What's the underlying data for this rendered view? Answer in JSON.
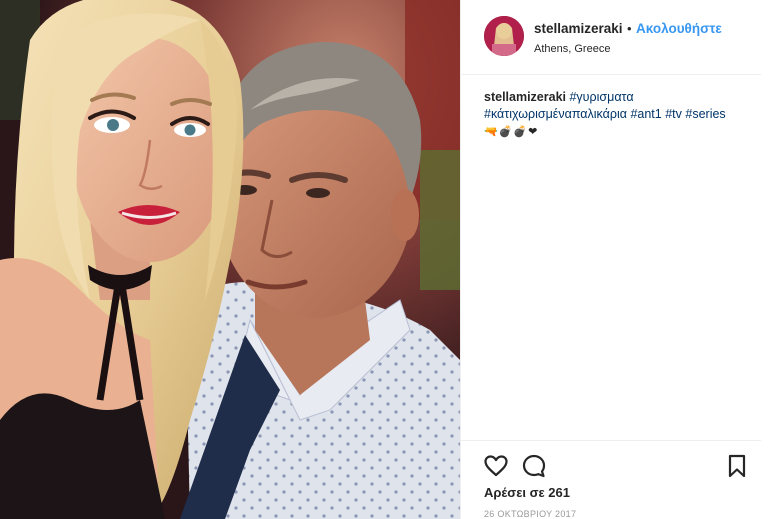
{
  "header": {
    "username": "stellamizeraki",
    "separator": "•",
    "follow_label": "Ακολουθήστε",
    "location": "Athens, Greece"
  },
  "caption": {
    "username": "stellamizeraki",
    "hashtags": [
      "#γυρισματα",
      "#κάτιχωρισμέναπαλικάρια",
      "#ant1",
      "#tv",
      "#series"
    ],
    "emoji_line": "🔫💣💣❤"
  },
  "actions": {
    "like_icon": "heart-outline-icon",
    "comment_icon": "speech-bubble-icon",
    "save_icon": "bookmark-icon"
  },
  "likes": {
    "text": "Αρέσει σε 261"
  },
  "date": {
    "text": "26 ΟΚΤΩΒΡΙΟΥ 2017"
  },
  "colors": {
    "accent": "#3897f0",
    "hashtag": "#003569",
    "text": "#262626",
    "muted": "#999999",
    "divider": "#efefef"
  }
}
